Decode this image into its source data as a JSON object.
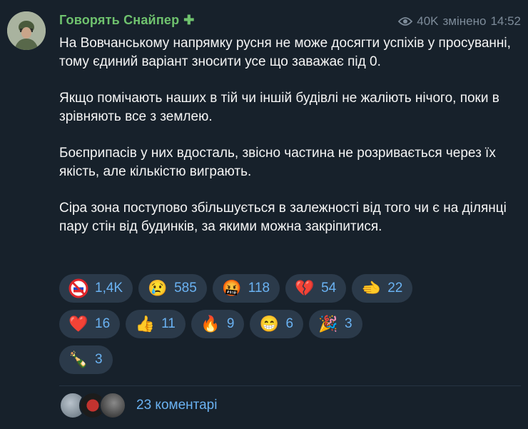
{
  "channel": {
    "name": "Говорять Снайпер",
    "badge": "✚"
  },
  "meta": {
    "views": "40K",
    "edited": "змінено",
    "time": "14:52"
  },
  "message": {
    "paragraphs": [
      "На Вовчанському напрямку русня не може досягти успіхів у просуванні, тому єдиний варіант зносити усе що заважає під 0.",
      "Якщо помічають наших в тій чи іншій будівлі не жаліють нічого, поки в зрівняють все з землею.",
      "Боєприпасів у них вдосталь, звісно частина не розривається через їх якість, але кількістю виграють.",
      "Сіра зона поступово збільшується в залежності від того чи є на ділянці пару стін від будинків, за якими можна закріпитися."
    ]
  },
  "reactions": [
    {
      "emoji": "🚫",
      "icon": "no-russia-flag-icon",
      "count": "1,4K"
    },
    {
      "emoji": "😢",
      "icon": "crying-face-icon",
      "count": "585"
    },
    {
      "emoji": "🤬",
      "icon": "cursing-face-icon",
      "count": "118"
    },
    {
      "emoji": "💔",
      "icon": "broken-heart-icon",
      "count": "54"
    },
    {
      "emoji": "🫲",
      "icon": "pointing-hand-icon",
      "count": "22"
    },
    {
      "emoji": "❤️",
      "icon": "red-heart-icon",
      "count": "16"
    },
    {
      "emoji": "👍",
      "icon": "thumbs-up-icon",
      "count": "11"
    },
    {
      "emoji": "🔥",
      "icon": "fire-icon",
      "count": "9"
    },
    {
      "emoji": "😁",
      "icon": "grinning-face-icon",
      "count": "6"
    },
    {
      "emoji": "🎉",
      "icon": "party-popper-icon",
      "count": "3"
    },
    {
      "emoji": "🍾",
      "icon": "champagne-bottle-icon",
      "count": "3"
    }
  ],
  "comments": {
    "label": "23 коментарі"
  },
  "colors": {
    "accent": "#6ab2f2",
    "channel": "#6fc26e",
    "background": "#17212b",
    "pill": "#2b3a4a"
  }
}
